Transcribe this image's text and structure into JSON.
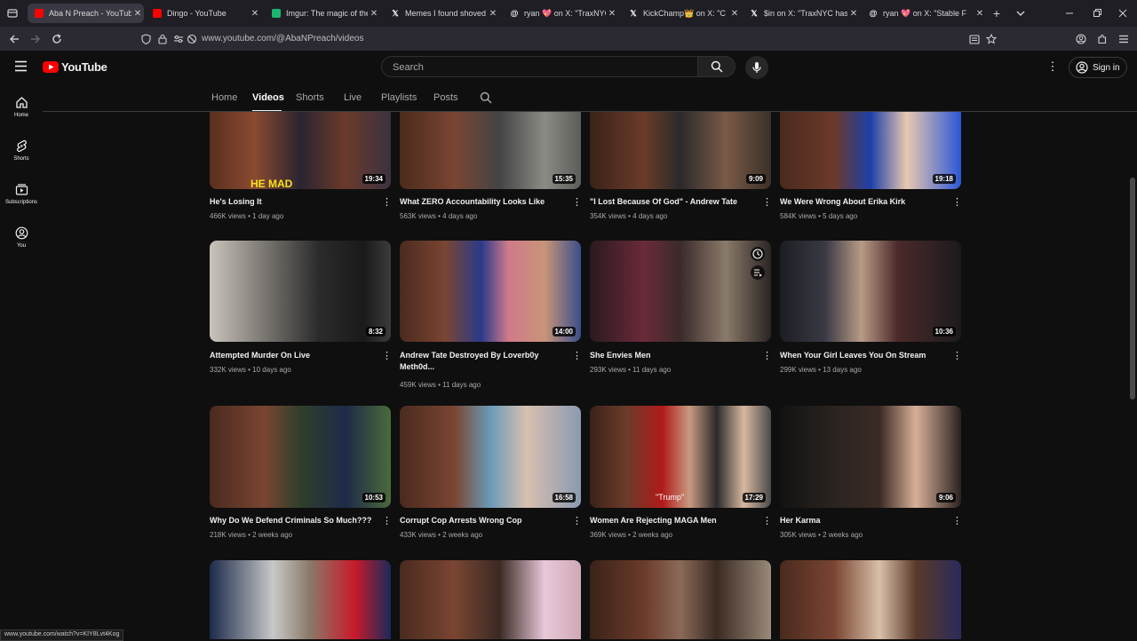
{
  "browser": {
    "tabs": [
      {
        "title": "Aba N Preach - YouTube",
        "icon": "youtube-icon",
        "active": true
      },
      {
        "title": "Dingo - YouTube",
        "icon": "youtube-icon"
      },
      {
        "title": "Imgur: The magic of the Int",
        "icon": "imgur-icon"
      },
      {
        "title": "Memes I found shoved",
        "icon": "x-icon"
      },
      {
        "title": "ryan 💖 on X: \"TraxNYC",
        "icon": "threads-icon"
      },
      {
        "title": "KickChamp👑 on X: \"C",
        "icon": "x-icon"
      },
      {
        "title": "$in on X: \"TraxNYC has",
        "icon": "x-icon"
      },
      {
        "title": "ryan 💖 on X: \"Stable F",
        "icon": "threads-icon"
      }
    ],
    "url": "www.youtube.com/@AbaNPreach/videos",
    "status_url": "www.youtube.com/watch?v=KIY8Lvt4Kog"
  },
  "header": {
    "logo_text": "YouTube",
    "search_placeholder": "Search",
    "signin_label": "Sign in"
  },
  "sidebar": {
    "items": [
      {
        "label": "Home",
        "icon": "home-icon"
      },
      {
        "label": "Shorts",
        "icon": "shorts-icon"
      },
      {
        "label": "Subscriptions",
        "icon": "subscriptions-icon"
      },
      {
        "label": "You",
        "icon": "you-icon"
      }
    ]
  },
  "channel_tabs": [
    "Home",
    "Videos",
    "Shorts",
    "Live",
    "Playlists",
    "Posts"
  ],
  "active_tab": "Videos",
  "videos": [
    {
      "title": "He's Losing It",
      "views": "466K views",
      "age": "1 day ago",
      "duration": "19:34",
      "overlay": "HE MAD"
    },
    {
      "title": "What ZERO Accountability Looks Like",
      "views": "563K views",
      "age": "4 days ago",
      "duration": "15:35"
    },
    {
      "title": "\"I Lost Because Of God\" - Andrew Tate",
      "views": "354K views",
      "age": "4 days ago",
      "duration": "9:09"
    },
    {
      "title": "We Were Wrong About Erika Kirk",
      "views": "584K views",
      "age": "5 days ago",
      "duration": "19:18"
    },
    {
      "title": "Attempted Murder On Live",
      "views": "332K views",
      "age": "10 days ago",
      "duration": "8:32"
    },
    {
      "title": "Andrew Tate Destroyed By Loverb0y Meth0d...",
      "views": "459K views",
      "age": "11 days ago",
      "duration": "14:00"
    },
    {
      "title": "She Envies Men",
      "views": "293K views",
      "age": "11 days ago",
      "duration": ""
    },
    {
      "title": "When Your Girl Leaves You On Stream",
      "views": "299K views",
      "age": "13 days ago",
      "duration": "10:36"
    },
    {
      "title": "Why Do We Defend Criminals So Much???",
      "views": "218K views",
      "age": "2 weeks ago",
      "duration": "10:53"
    },
    {
      "title": "Corrupt Cop Arrests Wrong Cop",
      "views": "433K views",
      "age": "2 weeks ago",
      "duration": "16:58"
    },
    {
      "title": "Women Are Rejecting MAGA Men",
      "views": "369K views",
      "age": "2 weeks ago",
      "duration": "17:29",
      "overlay": "\"Trump\""
    },
    {
      "title": "Her Karma",
      "views": "305K views",
      "age": "2 weeks ago",
      "duration": "9:06"
    },
    {
      "title": "",
      "views": "",
      "age": "",
      "duration": ""
    },
    {
      "title": "",
      "views": "",
      "age": "",
      "duration": ""
    },
    {
      "title": "",
      "views": "",
      "age": "",
      "duration": ""
    },
    {
      "title": "",
      "views": "",
      "age": "",
      "duration": ""
    }
  ]
}
